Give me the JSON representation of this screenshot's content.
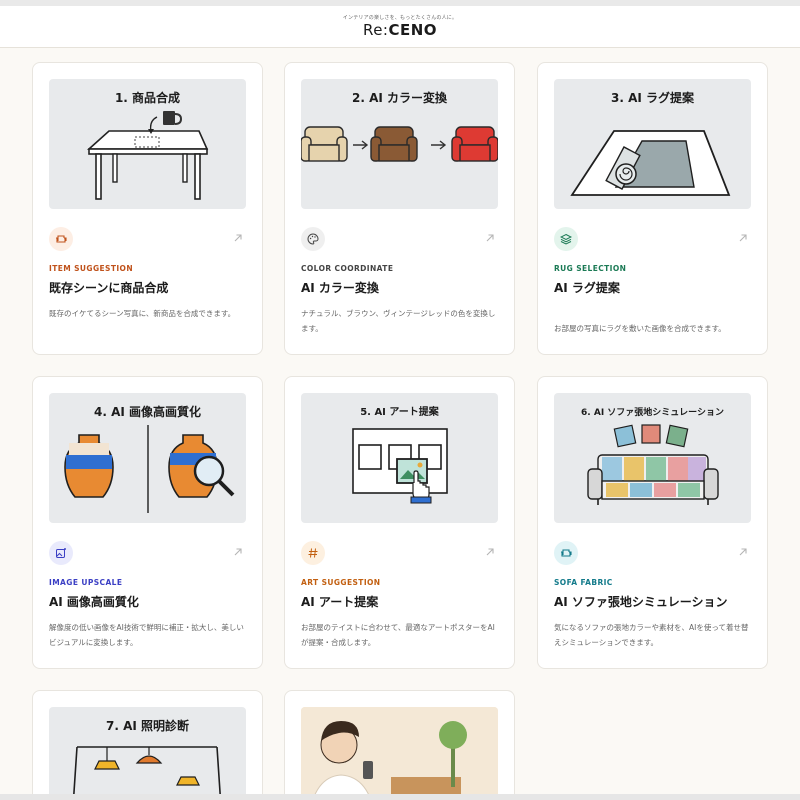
{
  "header": {
    "tagline": "インテリアの楽しさを、もっとたくさんの人に。",
    "logo_re": "Re:",
    "logo_main": "CENO"
  },
  "cards": [
    {
      "thumb_title": "1. 商品合成",
      "icon": "sofa-icon",
      "category": "ITEM SUGGESTION",
      "title": "既存シーンに商品合成",
      "desc": "既存のイケてるシーン写真に、新商品を合成できます。",
      "accent": "#c0521b",
      "icon_bg": "#fdeee4"
    },
    {
      "thumb_title": "2. AI カラー変換",
      "icon": "palette-icon",
      "category": "COLOR COORDINATE",
      "title": "AI カラー変換",
      "desc": "ナチュラル、ブラウン、ヴィンテージレッドの色を変換します。",
      "accent": "#444444",
      "icon_bg": "#efefef"
    },
    {
      "thumb_title": "3. AI ラグ提案",
      "icon": "layers-icon",
      "category": "RUG SELECTION",
      "title": "AI ラグ提案",
      "desc": "お部屋の写真にラグを敷いた画像を合成できます。",
      "accent": "#1b7a55",
      "icon_bg": "#e3f4ec"
    },
    {
      "thumb_title": "4. AI 画像高画質化",
      "icon": "image-sparkle-icon",
      "category": "IMAGE UPSCALE",
      "title": "AI 画像高画質化",
      "desc": "解像度の低い画像をAI技術で鮮明に補正・拡大し、美しいビジュアルに変換します。",
      "accent": "#3b3fc4",
      "icon_bg": "#e9eafc"
    },
    {
      "thumb_title": "5. AI アート提案",
      "icon": "hash-icon",
      "category": "ART SUGGESTION",
      "title": "AI アート提案",
      "desc": "お部屋のテイストに合わせて、最適なアートポスターをAIが提案・合成します。",
      "accent": "#c25f10",
      "icon_bg": "#fdf0e0"
    },
    {
      "thumb_title": "6. AI ソファ張地シミュレーション",
      "icon": "sofa-icon",
      "category": "SOFA FABRIC",
      "title": "AI ソファ張地シミュレーション",
      "desc": "気になるソファの張地カラーや素材を、AIを使って着せ替えシミュレーションできます。",
      "accent": "#127a8a",
      "icon_bg": "#e0f3f6"
    },
    {
      "thumb_title": "7. AI 照明診断"
    },
    {
      "thumb_title": ""
    }
  ]
}
